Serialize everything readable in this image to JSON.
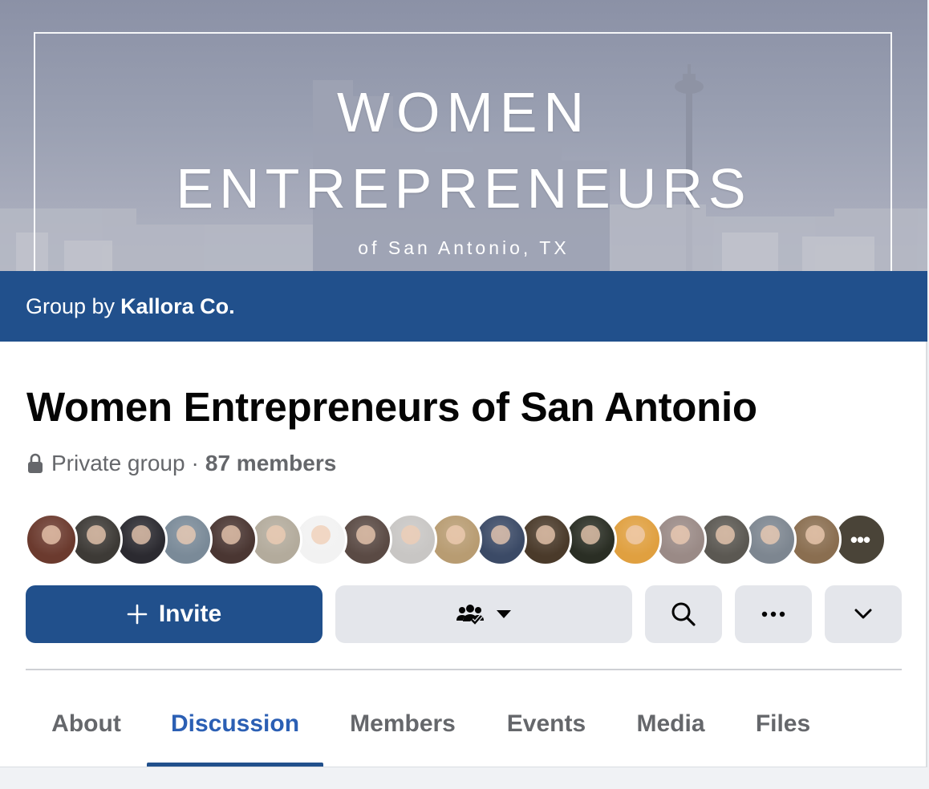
{
  "cover": {
    "line1": "WOMEN",
    "line2": "ENTREPRENEURS",
    "line3": "of San Antonio, TX"
  },
  "group_by": {
    "prefix": "Group by",
    "owner": "Kallora Co."
  },
  "group": {
    "title": "Women Entrepreneurs of San Antonio",
    "privacy": "Private group",
    "separator": "·",
    "members": "87 members"
  },
  "member_avatars": [
    {
      "bg": "#6b3a2e"
    },
    {
      "bg": "#3d3a36"
    },
    {
      "bg": "#2b2a30"
    },
    {
      "bg": "#7a8a98"
    },
    {
      "bg": "#4a3632"
    },
    {
      "bg": "#b3ab9c"
    },
    {
      "bg": "#f2f2f2"
    },
    {
      "bg": "#5a4a44"
    },
    {
      "bg": "#c8c6c4"
    },
    {
      "bg": "#b89c72"
    },
    {
      "bg": "#3b4a66"
    },
    {
      "bg": "#4a3a2a"
    },
    {
      "bg": "#2a2e24"
    },
    {
      "bg": "#e0a040"
    },
    {
      "bg": "#9a8a86"
    },
    {
      "bg": "#5b5852"
    },
    {
      "bg": "#7d8690"
    },
    {
      "bg": "#8a6e50"
    }
  ],
  "more_avatars_icon": "more-dots",
  "actions": {
    "invite_label": "Invite",
    "invite_icon": "plus-icon",
    "joined_icon": "group-members-icon",
    "search_icon": "search-icon",
    "more_icon": "more-dots-icon",
    "collapse_icon": "chevron-down-icon"
  },
  "tabs": [
    {
      "label": "About",
      "active": false
    },
    {
      "label": "Discussion",
      "active": true
    },
    {
      "label": "Members",
      "active": false
    },
    {
      "label": "Events",
      "active": false
    },
    {
      "label": "Media",
      "active": false
    },
    {
      "label": "Files",
      "active": false
    }
  ],
  "colors": {
    "brand": "#21508c",
    "active_tab": "#2b5fb4",
    "secondary_text": "#65676b",
    "button_gray": "#e4e6eb"
  }
}
